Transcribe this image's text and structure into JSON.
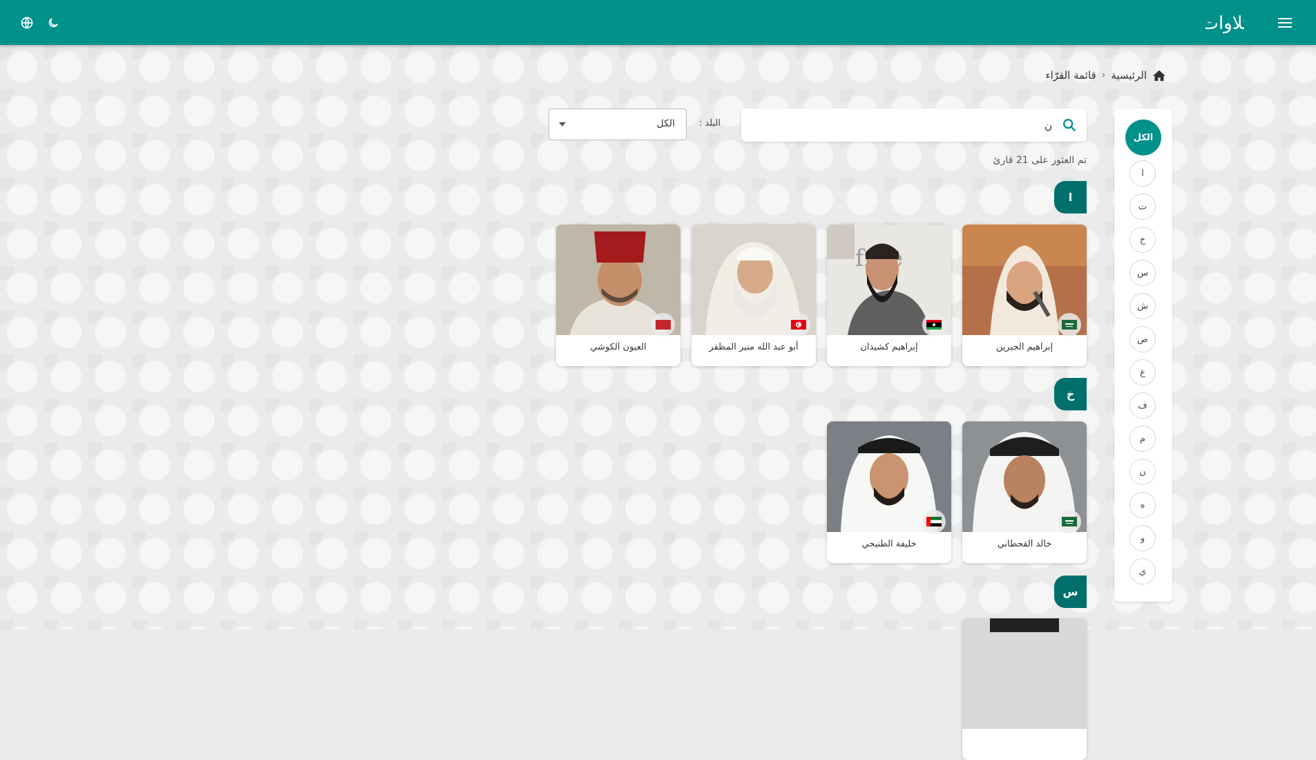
{
  "header": {
    "logo_text": "تلاوات",
    "menu_icon": "hamburger-menu-icon",
    "theme_icon": "moon-icon",
    "language_icon": "globe-icon",
    "brand_color": "#00918a"
  },
  "breadcrumb": {
    "home_icon": "home-icon",
    "home_label": "الرئيسية",
    "separator": "‹",
    "current": "قائمة القرّاء"
  },
  "letters": {
    "all_label": "الكل",
    "items": [
      "ا",
      "ت",
      "خ",
      "س",
      "ش",
      "ص",
      "ع",
      "ف",
      "م",
      "ن",
      "ه",
      "و",
      "ي"
    ]
  },
  "search": {
    "value": "ن",
    "placeholder": "",
    "icon": "search-icon"
  },
  "filter": {
    "label": "البلد :",
    "selected": "الكل"
  },
  "results_text": "تم العثور على 21 قارئ",
  "sections": [
    {
      "letter": "ا",
      "reciters": [
        {
          "name": "إبراهيم الجبرين",
          "flag": "saudi-arabia-flag"
        },
        {
          "name": "إبراهيم كشيدان",
          "flag": "libya-flag"
        },
        {
          "name": "أبو عبد الله منير المظفر",
          "flag": "tunisia-flag"
        },
        {
          "name": "العيون الكوشي",
          "flag": "morocco-flag"
        }
      ]
    },
    {
      "letter": "خ",
      "reciters": [
        {
          "name": "خالد القحطاني",
          "flag": "saudi-arabia-flag"
        },
        {
          "name": "خليفة الطنيجي",
          "flag": "uae-flag"
        }
      ]
    },
    {
      "letter": "س",
      "reciters": []
    }
  ]
}
